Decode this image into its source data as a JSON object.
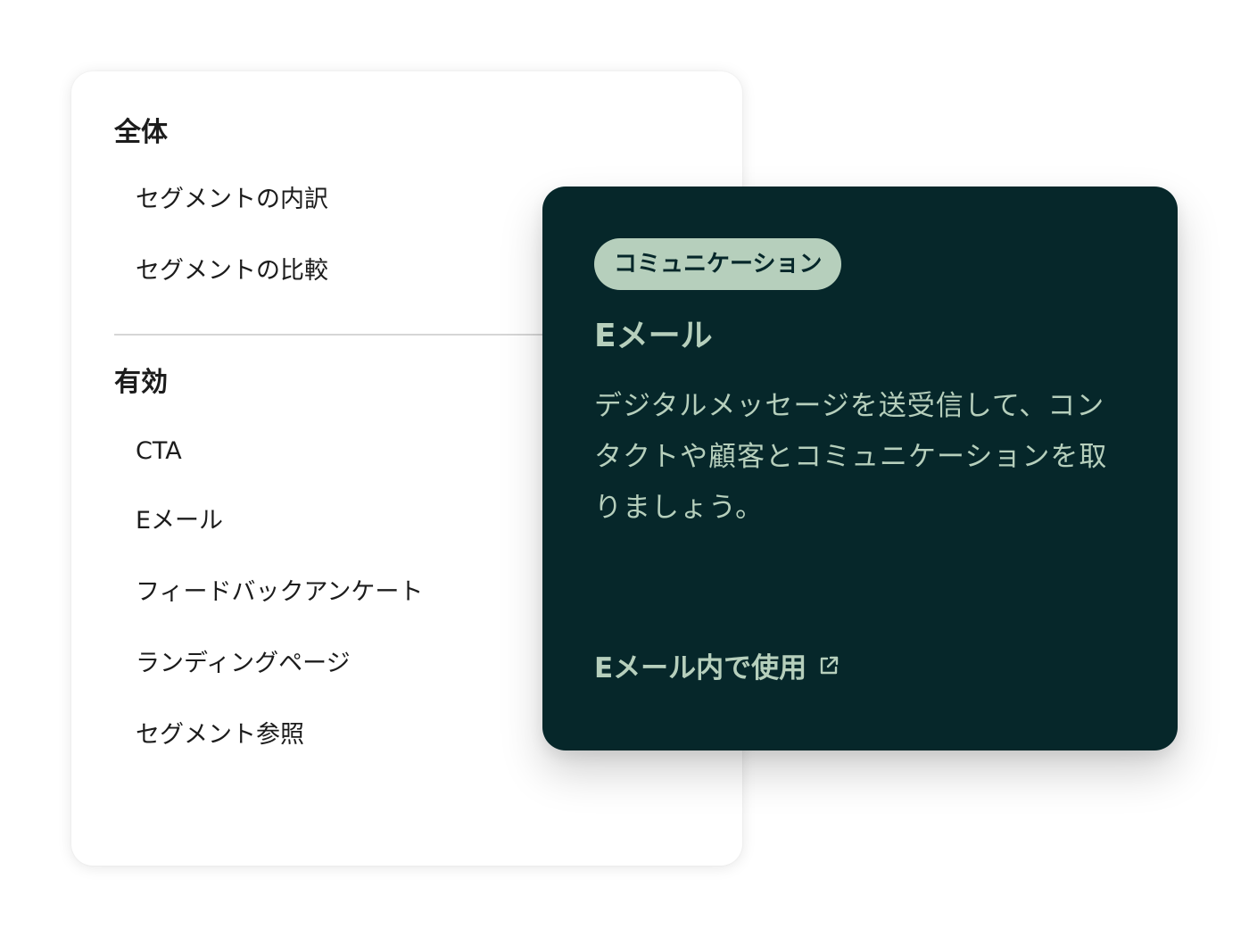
{
  "menu": {
    "overall": {
      "heading": "全体",
      "items": [
        "セグメントの内訳",
        "セグメントの比較"
      ]
    },
    "active": {
      "heading": "有効",
      "items": [
        "CTA",
        "Eメール",
        "フィードバックアンケート",
        "ランディングページ",
        "セグメント参照"
      ]
    }
  },
  "info": {
    "tag": "コミュニケーション",
    "title": "Eメール",
    "description": "デジタルメッセージを送受信して、コンタクトや顧客とコミュニケーションを取りましょう。",
    "link_label": "Eメール内で使用",
    "link_icon": "external-link-icon"
  },
  "colors": {
    "card_dark": "#06272a",
    "accent_mint": "#b6cfbc",
    "text_dark": "#1c1c1c",
    "divider": "#d6d6d6"
  }
}
